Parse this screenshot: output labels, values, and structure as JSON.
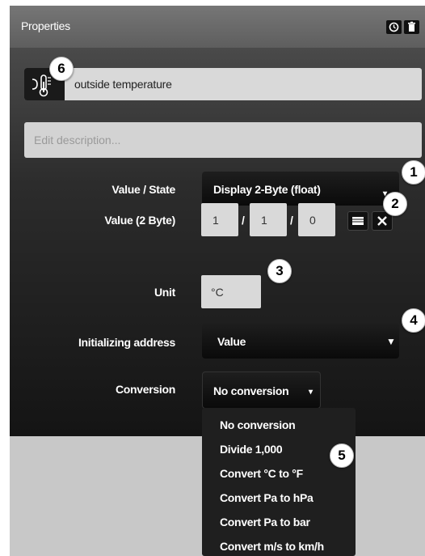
{
  "header": {
    "title": "Properties"
  },
  "object": {
    "name": "outside temperature",
    "description_placeholder": "Edit description..."
  },
  "rows": {
    "value_state": {
      "label": "Value / State",
      "value": "Display 2-Byte (float)"
    },
    "value_2byte": {
      "label": "Value (2 Byte)",
      "main_group": "1",
      "middle_group": "1",
      "sub_group": "0"
    },
    "unit": {
      "label": "Unit",
      "value": "°C"
    },
    "init": {
      "label": "Initializing address",
      "value": "Value"
    },
    "conversion": {
      "label": "Conversion",
      "value": "No conversion"
    }
  },
  "conversion_menu": {
    "items": [
      "No conversion",
      "Divide 1,000",
      "Convert °C to °F",
      "Convert Pa to hPa",
      "Convert Pa to bar",
      "Convert m/s to km/h"
    ]
  },
  "badges": [
    "1",
    "2",
    "3",
    "4",
    "5",
    "6"
  ],
  "icons": [
    "clock-icon",
    "trash-icon",
    "thermometer-icon",
    "group-address-icon",
    "clear-icon",
    "caret-down-icon"
  ],
  "colors": {
    "panel_bg": "#c8c8c8",
    "header_bg": "#6a6a6a",
    "body_dark": "#141414",
    "field_bg": "#d9d9d9"
  }
}
